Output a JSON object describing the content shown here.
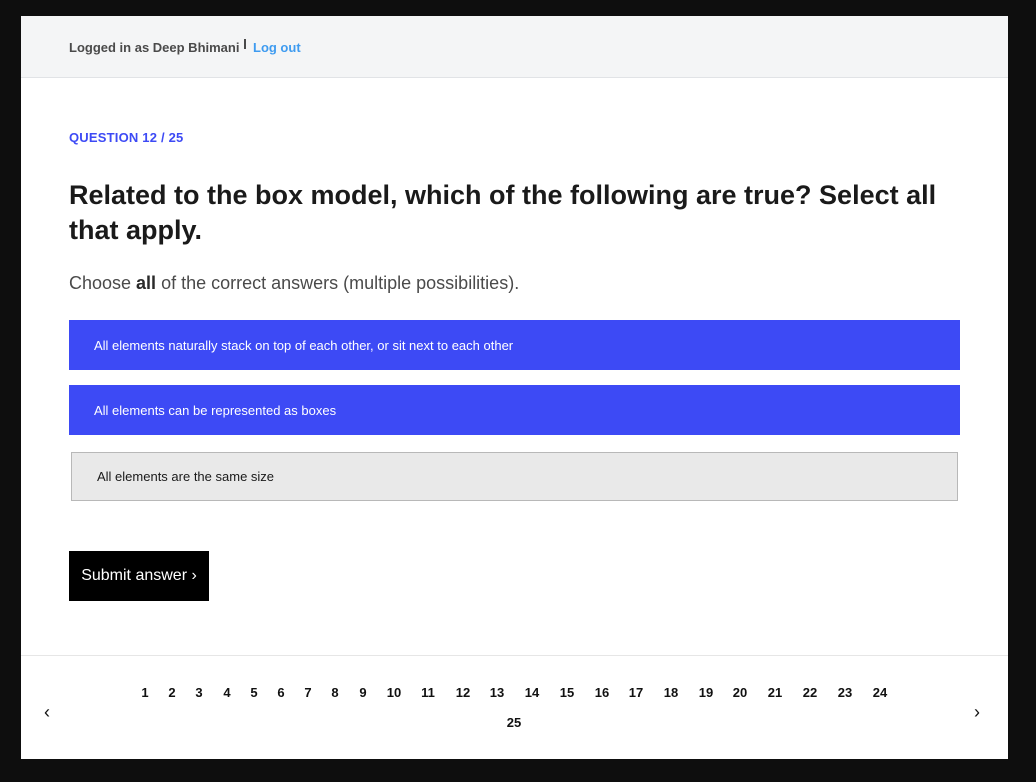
{
  "header": {
    "logged_in_text": "Logged in as Deep Bhimani",
    "logout_label": "Log out"
  },
  "quiz": {
    "question_counter": "QUESTION 12 / 25",
    "question_text": "Related to the box model, which of the following are true? Select all that apply.",
    "instruction_prefix": "Choose ",
    "instruction_bold": "all",
    "instruction_suffix": " of the correct answers (multiple possibilities).",
    "options": [
      {
        "label": "All elements naturally stack on top of each other, or sit next to each other",
        "selected": true
      },
      {
        "label": "All elements can be represented as boxes",
        "selected": true
      },
      {
        "label": "All elements are the same size",
        "selected": false
      }
    ],
    "submit_label": "Submit answer ›"
  },
  "pagination": {
    "prev_icon": "‹",
    "next_icon": "›",
    "pages": [
      "1",
      "2",
      "3",
      "4",
      "5",
      "6",
      "7",
      "8",
      "9",
      "10",
      "11",
      "12",
      "13",
      "14",
      "15",
      "16",
      "17",
      "18",
      "19",
      "20",
      "21",
      "22",
      "23",
      "24",
      "25"
    ],
    "current_page": "12"
  },
  "colors": {
    "accent": "#3d4af5",
    "link": "#3e9bf0",
    "option_unselected_bg": "#e9e9e9",
    "submit_bg": "#000000"
  }
}
